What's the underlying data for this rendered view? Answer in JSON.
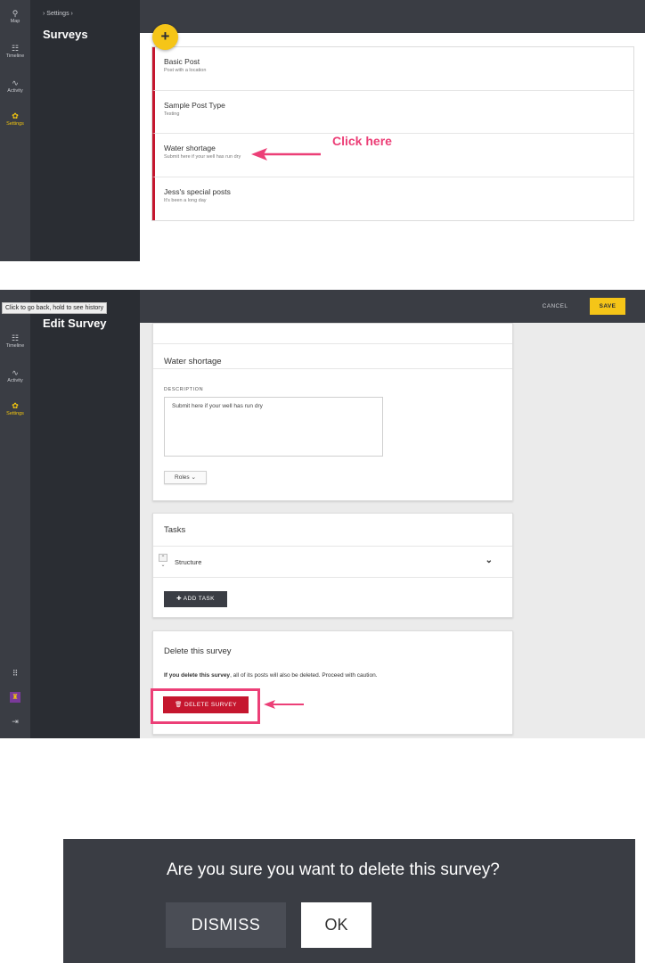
{
  "colors": {
    "accent_yellow": "#f5c518",
    "danger_red": "#c5162e",
    "annotation_pink": "#ec3f77",
    "sidebar_dark": "#2a2d33"
  },
  "nav": {
    "map": {
      "label": "Map",
      "icon": "map-pin-icon"
    },
    "timeline": {
      "label": "Timeline",
      "icon": "timeline-icon"
    },
    "activity": {
      "label": "Activity",
      "icon": "activity-icon"
    },
    "settings": {
      "label": "Settings",
      "icon": "gear-icon"
    },
    "bottom_icons": [
      "grid-icon",
      "avatar-icon",
      "logout-icon"
    ]
  },
  "surveys_screen": {
    "breadcrumb": "› Settings ›",
    "title": "Surveys",
    "add_label": "+",
    "posts": [
      {
        "title": "Basic Post",
        "subtitle": "Post with a location"
      },
      {
        "title": "Sample Post Type",
        "subtitle": "Testing"
      },
      {
        "title": "Water shortage",
        "subtitle": "Submit here if your well has run dry"
      },
      {
        "title": "Jess's special posts",
        "subtitle": "It's been a long day"
      }
    ],
    "annotation": "Click here"
  },
  "edit_screen": {
    "tooltip": "Click to go back, hold to see history",
    "title": "Edit Survey",
    "cancel_label": "CANCEL",
    "save_label": "SAVE",
    "survey_name": "Water shortage",
    "description_label": "DESCRIPTION",
    "description_value": "Submit here if your well has run dry",
    "roles_label": "Roles",
    "tasks_title": "Tasks",
    "task_name": "Structure",
    "add_task_label": "ADD TASK",
    "delete_title": "Delete this survey",
    "delete_note_bold": "If you delete this survey",
    "delete_note_rest": ", all of its posts will also be deleted. Proceed with caution.",
    "delete_button": "DELETE SURVEY"
  },
  "dialog": {
    "message": "Are you sure you want to delete this survey?",
    "dismiss_label": "DISMISS",
    "ok_label": "OK"
  }
}
